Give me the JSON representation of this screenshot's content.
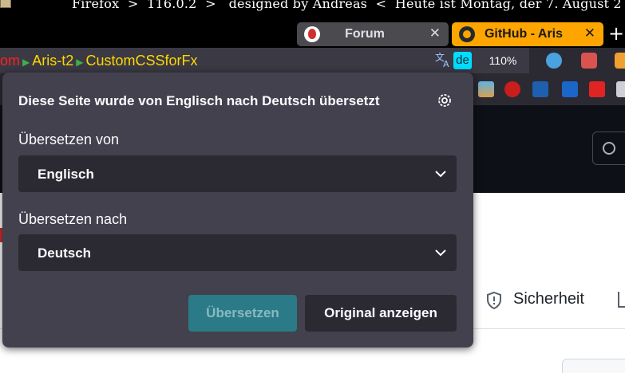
{
  "window": {
    "title": "Firefox  >  116.0.2  >   designed by Andreas  <  Heute ist Montag, der 7. August 2"
  },
  "tabs": [
    {
      "label": "Forum",
      "icon": "forum-flame-icon",
      "active": false
    },
    {
      "label": "GitHub - Aris",
      "icon": "github-icon",
      "active": true
    }
  ],
  "urlbar": {
    "crumbs": [
      "om",
      "Aris-t2",
      "CustomCSSforFx"
    ],
    "lang_badge": "de",
    "zoom": "110%"
  },
  "page": {
    "security_label": "Sicherheit"
  },
  "translation_panel": {
    "title": "Diese Seite wurde von Englisch nach Deutsch übersetzt",
    "from_label": "Übersetzen von",
    "from_value": "Englisch",
    "to_label": "Übersetzen nach",
    "to_value": "Deutsch",
    "translate_button": "Übersetzen",
    "original_button": "Original anzeigen"
  },
  "colors": {
    "panel_bg": "#42414d",
    "select_bg": "#2b2a33",
    "active_tab": "#ffa500",
    "accent_button": "#2a7b87",
    "badge": "#00ddff"
  }
}
